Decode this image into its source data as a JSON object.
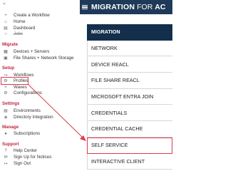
{
  "sidebar": {
    "top_items": [
      {
        "icon": "plus-icon",
        "label": "Create a Workflow"
      },
      {
        "icon": "home-icon",
        "label": "Home"
      },
      {
        "icon": "dashboard-icon",
        "label": "Dashboard"
      },
      {
        "icon": "item-icon",
        "label": "Jobs"
      }
    ],
    "sections": [
      {
        "title": "Migrate",
        "items": [
          {
            "icon": "server-icon",
            "label": "Devices + Servers"
          },
          {
            "icon": "folder-icon",
            "label": "File Shares + Network Storage"
          }
        ]
      },
      {
        "title": "Setup",
        "items": [
          {
            "icon": "workflow-icon",
            "label": "Workflows"
          },
          {
            "icon": "profile-icon",
            "label": "Profiles"
          },
          {
            "icon": "wave-icon",
            "label": "Waves"
          },
          {
            "icon": "gear-icon",
            "label": "Configurations"
          }
        ]
      },
      {
        "title": "Settings",
        "items": [
          {
            "icon": "environment-icon",
            "label": "Environments"
          },
          {
            "icon": "directory-icon",
            "label": "Directory Integration"
          }
        ]
      },
      {
        "title": "Manage",
        "items": [
          {
            "icon": "subscription-icon",
            "label": "Subscriptions"
          }
        ]
      },
      {
        "title": "Support",
        "items": [
          {
            "icon": "help-icon",
            "label": "Help Center"
          },
          {
            "icon": "notice-icon",
            "label": "Sign Up for Notices"
          },
          {
            "icon": "signout-icon",
            "label": "Sign Out"
          }
        ]
      }
    ]
  },
  "header": {
    "title_bold": "MIGRATION",
    "title_mid": "FOR",
    "title_end": "AC"
  },
  "menu": {
    "items": [
      "MIGRATION",
      "NETWORK",
      "DEVICE REACL",
      "FILE SHARE REACL",
      "MICROSOFT ENTRA JOIN",
      "CREDENTIALS",
      "CREDENTIAL CACHE",
      "SELF SERVICE",
      "INTERACTIVE CLIENT"
    ],
    "active_index": 0,
    "highlighted_index": 7
  },
  "colors": {
    "header_bg": "#1f3a58",
    "active_bg": "#142f4c",
    "section_title": "#c0273c",
    "highlight": "#e03a4b"
  }
}
